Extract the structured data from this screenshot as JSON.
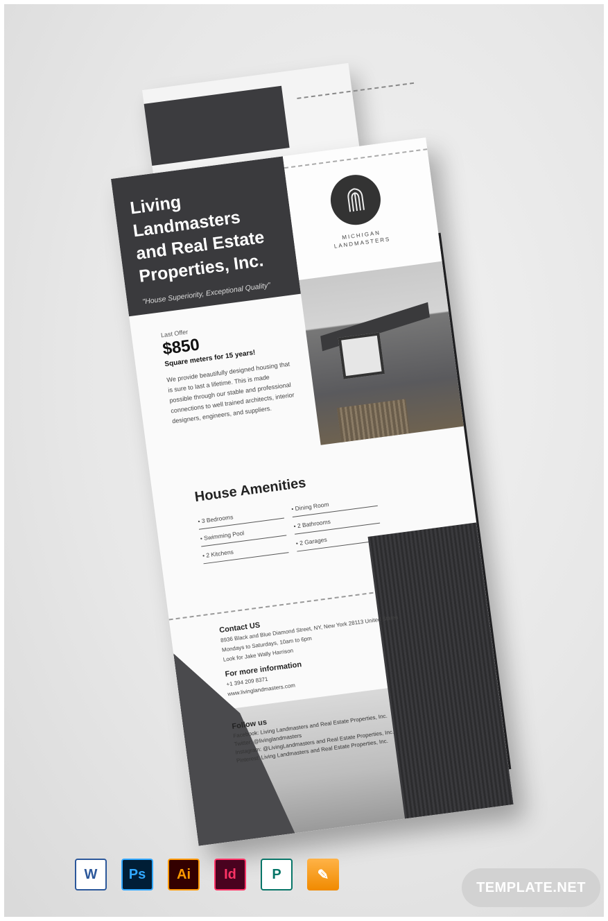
{
  "flyer": {
    "company_name": "Living Landmasters and Real Estate Properties, Inc.",
    "tagline": "\"House Superiority, Exceptional Quality\"",
    "logo_text": "MICHIGAN LANDMASTERS",
    "offer": {
      "label": "Last Offer",
      "price": "$850",
      "subtitle": "Square meters for 15 years!",
      "body": "We provide beautifully designed housing that is sure to last a lifetime. This is made possible through our stable and professional connections to well trained architects, interior designers, engineers, and suppliers."
    },
    "amenities": {
      "title": "House Amenities",
      "items": [
        "• 3 Bedrooms",
        "• Dining Room",
        "• Swimming Pool",
        "• 2 Bathrooms",
        "• 2 Kitchens",
        "• 2 Garages"
      ]
    },
    "contact": {
      "title": "Contact US",
      "address": "8936 Black and Blue Diamond Street, NY, New York 28113 United States",
      "hours": "Mondays to Saturdays, 10am to 6pm",
      "person": "Look for Jake Wally Harrison"
    },
    "more_info": {
      "title": "For more information",
      "phone": "+1 394 209 8371",
      "email": "www.livinglandmasters.com"
    },
    "follow": {
      "title": "Follow us",
      "lines": [
        "Facebook: Living Landmasters and Real Estate Properties, Inc.",
        "Twitter: @livinglandmasters",
        "Instagram: @LivingLandmasters and Real Estate Properties, Inc.",
        "Pinterest: Living Landmasters and Real Estate Properties, Inc."
      ]
    }
  },
  "app_icons": [
    {
      "name": "word-icon",
      "glyph": "W"
    },
    {
      "name": "photoshop-icon",
      "glyph": "Ps"
    },
    {
      "name": "illustrator-icon",
      "glyph": "Ai"
    },
    {
      "name": "indesign-icon",
      "glyph": "Id"
    },
    {
      "name": "publisher-icon",
      "glyph": "P"
    },
    {
      "name": "pages-icon",
      "glyph": "✎"
    }
  ],
  "brand": "TEMPLATE.NET"
}
